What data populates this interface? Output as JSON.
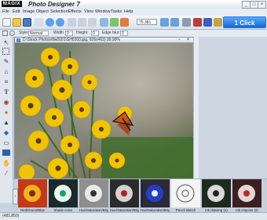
{
  "app": {
    "logo": "MAGIX",
    "title": "Photo Designer 7",
    "window_buttons": [
      "_",
      "□",
      "×"
    ]
  },
  "menu": [
    "File",
    "Edit",
    "Image",
    "Object",
    "Selection",
    "Effects",
    "View",
    "Window",
    "Tasks",
    "Help"
  ],
  "toolbar": {
    "zoom_value": "75.381",
    "one_click_label": "1 Click",
    "one_click_color": "#1f7ae6"
  },
  "options": {
    "style_label": "Style:",
    "style_value": "Normal",
    "width_label": "Width",
    "width_value": "0",
    "height_label": "Height",
    "height_value": "0",
    "edge_blur_label": "Edge blur:",
    "edge_blur_value": "0"
  },
  "document": {
    "title": "D:\\Stock Photos\\flw0001\\SH0303.jpg, 626x463) 99.99%"
  },
  "filmstrip": {
    "thumbnails": [
      {
        "label": "Red/Green/Blue"
      },
      {
        "label": "Shade curve"
      },
      {
        "label": "Hue/Saturation/Brigh..."
      },
      {
        "label": "Hue/Saturation/Brigh..."
      },
      {
        "label": "Hue/Saturation/Brigh..."
      },
      {
        "label": "Pencil sketch"
      },
      {
        "label": "Ink drawing (1)"
      },
      {
        "label": "Ink crayons (2)"
      }
    ]
  },
  "status": {
    "text": "(481,850)"
  }
}
